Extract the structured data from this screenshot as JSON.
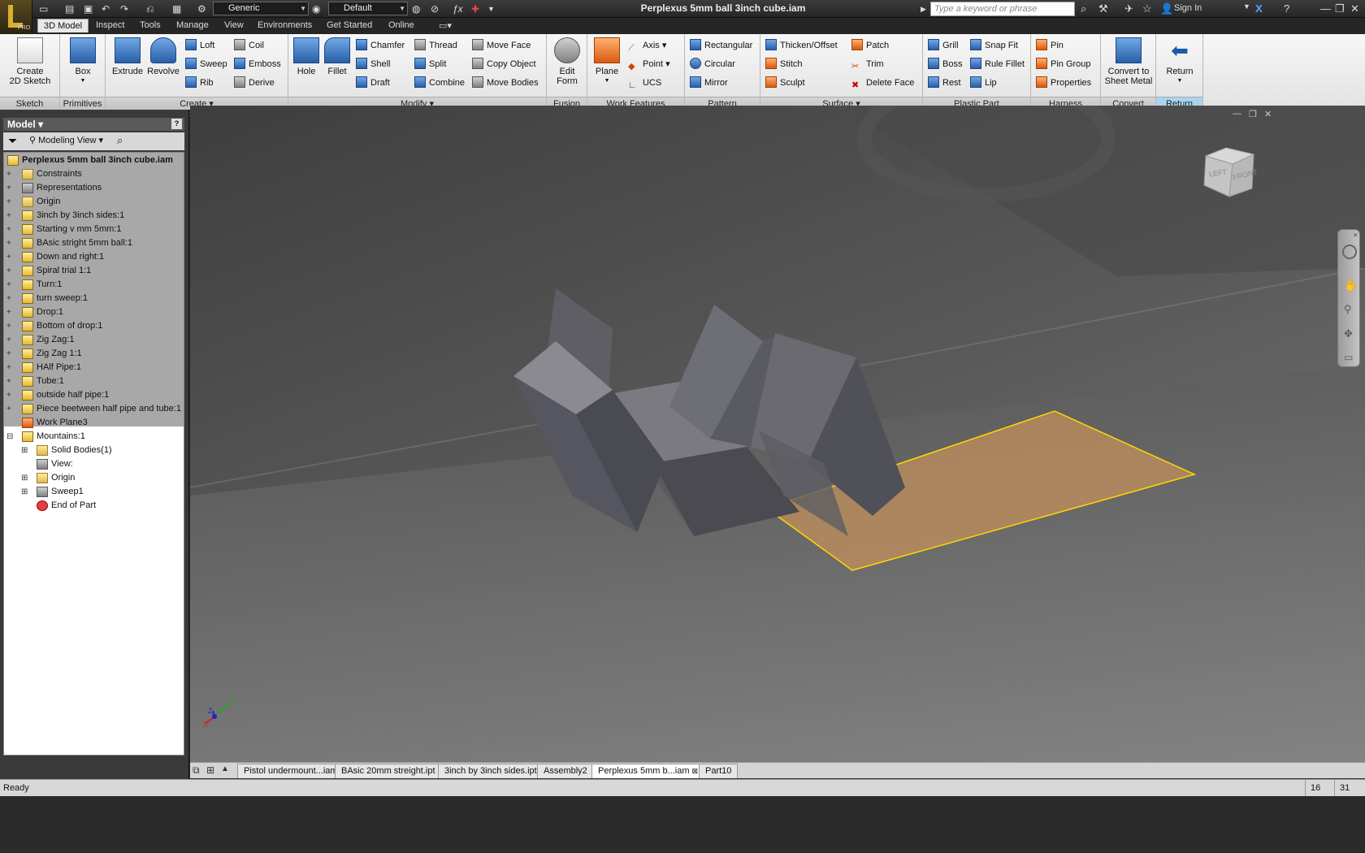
{
  "titlebar": {
    "document_title": "Perplexus 5mm ball 3inch cube.iam",
    "material": "Generic",
    "appearance": "Default",
    "search_placeholder": "Type a keyword or phrase",
    "sign_in": "Sign In",
    "app_badge": "PRO"
  },
  "menu": [
    "3D Model",
    "Inspect",
    "Tools",
    "Manage",
    "View",
    "Environments",
    "Get Started",
    "Online"
  ],
  "ribbon": {
    "sketch": {
      "label": "Sketch",
      "create": "Create",
      "create2": "2D Sketch"
    },
    "primitives": {
      "label": "Primitives",
      "box": "Box"
    },
    "create": {
      "label": "Create",
      "extrude": "Extrude",
      "revolve": "Revolve",
      "loft": "Loft",
      "sweep": "Sweep",
      "rib": "Rib",
      "coil": "Coil",
      "emboss": "Emboss",
      "derive": "Derive"
    },
    "modify": {
      "label": "Modify",
      "hole": "Hole",
      "fillet": "Fillet",
      "chamfer": "Chamfer",
      "shell": "Shell",
      "draft": "Draft",
      "thread": "Thread",
      "split": "Split",
      "combine": "Combine",
      "move_face": "Move Face",
      "copy_object": "Copy Object",
      "move_bodies": "Move Bodies"
    },
    "fusion": {
      "label": "Fusion",
      "edit": "Edit",
      "form": "Form"
    },
    "work_features": {
      "label": "Work Features",
      "plane": "Plane",
      "axis": "Axis",
      "point": "Point",
      "ucs": "UCS"
    },
    "pattern": {
      "label": "Pattern",
      "rectangular": "Rectangular",
      "circular": "Circular",
      "mirror": "Mirror"
    },
    "surface": {
      "label": "Surface",
      "thicken": "Thicken/Offset",
      "stitch": "Stitch",
      "sculpt": "Sculpt",
      "patch": "Patch",
      "trim": "Trim",
      "delete_face": "Delete Face"
    },
    "plastic": {
      "label": "Plastic Part",
      "grill": "Grill",
      "boss": "Boss",
      "rest": "Rest",
      "snap_fit": "Snap Fit",
      "rule_fillet": "Rule Fillet",
      "lip": "Lip"
    },
    "harness": {
      "label": "Harness",
      "pin": "Pin",
      "pin_group": "Pin Group",
      "properties": "Properties"
    },
    "convert": {
      "label": "Convert",
      "line1": "Convert to",
      "line2": "Sheet Metal"
    },
    "return": {
      "label": "Return",
      "button": "Return"
    }
  },
  "browser": {
    "title": "Model",
    "view": "Modeling View",
    "root": "Perplexus 5mm ball 3inch cube.iam",
    "items": [
      "Constraints",
      "Representations",
      "Origin",
      "3inch by 3inch sides:1",
      "Starting v mm 5mm:1",
      "BAsic stright 5mm ball:1",
      "Down and right:1",
      "Spiral trial 1:1",
      "Turn:1",
      "turn sweep:1",
      "Drop:1",
      "Bottom of drop:1",
      "Zig Zag:1",
      "Zig Zag 1:1",
      "HAlf Pipe:1",
      "Tube:1",
      "outside half pipe:1",
      "Piece beetween half pipe and tube:1",
      "Work Plane3",
      "Mountains:1"
    ],
    "children": [
      "Solid Bodies(1)",
      "View:",
      "Origin",
      "Sweep1",
      "End of Part"
    ]
  },
  "viewcube": {
    "left": "LEFT",
    "front": "FRONT"
  },
  "doc_tabs": [
    "Pistol undermount...iam",
    "BAsic 20mm streight.ipt",
    "3inch by 3inch sides.ipt",
    "Assembly2",
    "Perplexus 5mm b...iam",
    "Part10"
  ],
  "status": {
    "text": "Ready",
    "count1": "16",
    "count2": "31"
  },
  "colors": {
    "ribbon_bg": "#e6e6e6",
    "dark_chrome": "#262626",
    "plane_fill": "#c8935a",
    "plane_edge": "#ffd800",
    "part_face": "#6c6c72"
  }
}
